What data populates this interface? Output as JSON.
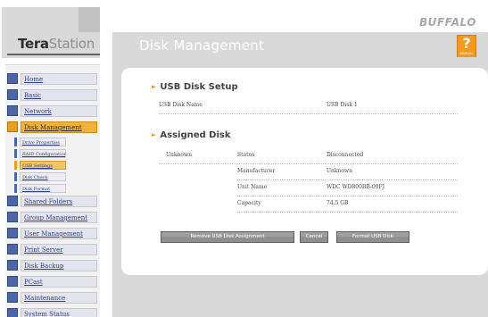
{
  "brand": {
    "logo_bold": "Tera",
    "logo_light": "Station",
    "vendor": "BUFFALO"
  },
  "header": {
    "title": "Disk Management",
    "help_symbol": "?",
    "help_label": "MANUAL"
  },
  "sidebar": {
    "items": [
      {
        "label": "Home",
        "icon": "home-icon",
        "active": false
      },
      {
        "label": "Basic",
        "icon": "basic-settings-icon",
        "active": false
      },
      {
        "label": "Network",
        "icon": "network-icon",
        "active": false
      },
      {
        "label": "Disk Management",
        "icon": "disk-management-icon",
        "active": true
      },
      {
        "label": "Shared Folders",
        "icon": "shared-folders-icon",
        "active": false
      },
      {
        "label": "Group Management",
        "icon": "group-management-icon",
        "active": false
      },
      {
        "label": "User Management",
        "icon": "user-management-icon",
        "active": false
      },
      {
        "label": "Print Server",
        "icon": "print-server-icon",
        "active": false
      },
      {
        "label": "Disk Backup",
        "icon": "disk-backup-icon",
        "active": false
      },
      {
        "label": "PCast",
        "icon": "pcast-icon",
        "active": false
      },
      {
        "label": "Maintenance",
        "icon": "maintenance-icon",
        "active": false
      },
      {
        "label": "System Status",
        "icon": "system-status-icon",
        "active": false
      }
    ],
    "subitems": [
      {
        "label": "Drive Properties",
        "active": false
      },
      {
        "label": "RAID Configuration",
        "active": false
      },
      {
        "label": "USB Settings",
        "active": true
      },
      {
        "label": "Disk Check",
        "active": false
      },
      {
        "label": "Disk Format",
        "active": false
      }
    ]
  },
  "usb_setup": {
    "heading": "USB Disk Setup",
    "name_label": "USB Disk Name",
    "name_value": "USB Disk 1"
  },
  "assigned": {
    "heading": "Assigned Disk",
    "disk": "Unknown",
    "status_label": "Status",
    "status_value": "Disconnected",
    "manufacturer_label": "Manufacturer",
    "manufacturer_value": "Unknown",
    "unit_label": "Unit Name",
    "unit_value": "WDC WD800BB-00FJ",
    "capacity_label": "Capacity",
    "capacity_value": "74.5 GB"
  },
  "buttons": {
    "remove": "Remove USB Disk Assignment",
    "cancel": "Cancel",
    "format": "Format USB Disk"
  },
  "colors": {
    "accent": "#e8a019",
    "nav_icon": "#4b66a6",
    "title_band": "#d9d9d9",
    "button": "#8f8f8f"
  }
}
